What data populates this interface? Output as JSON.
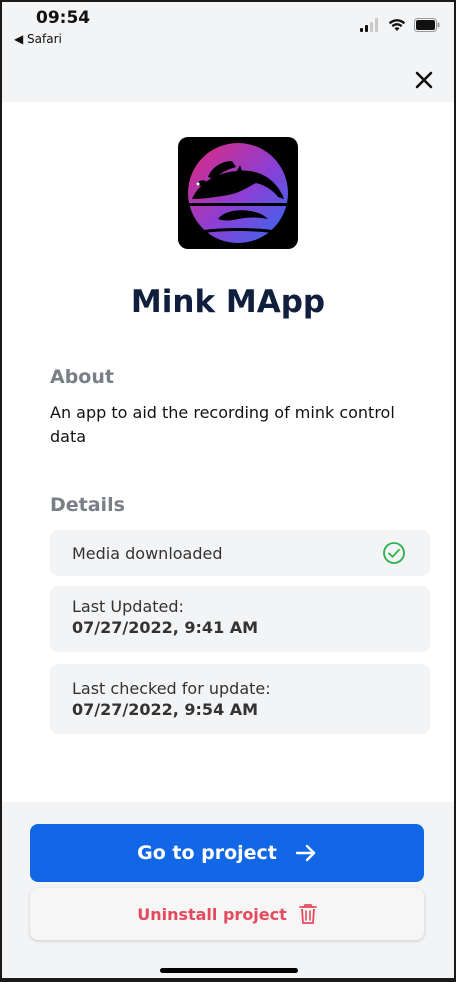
{
  "status_bar": {
    "time": "09:54",
    "back_label": "◀ Safari",
    "icons": [
      "signal-icon",
      "wifi-icon",
      "battery-icon"
    ]
  },
  "header": {
    "close_icon": "close-icon"
  },
  "app": {
    "title": "Mink MApp",
    "logo_icon": "mink-logo"
  },
  "about": {
    "heading": "About",
    "text": "An app to aid the recording of mink control data"
  },
  "details": {
    "heading": "Details",
    "media_status": "Media downloaded",
    "media_icon": "check-circle-icon",
    "last_updated_label": "Last Updated:",
    "last_updated_value": "07/27/2022, 9:41 AM",
    "last_checked_label": "Last checked for update:",
    "last_checked_value": "07/27/2022, 9:54 AM"
  },
  "actions": {
    "go_label": "Go to project",
    "go_icon": "arrow-right-icon",
    "uninstall_label": "Uninstall project",
    "uninstall_icon": "trash-icon"
  },
  "colors": {
    "primary": "#1167e6",
    "danger": "#e44a5d",
    "success": "#2bb24c",
    "title": "#0f1f3d"
  }
}
